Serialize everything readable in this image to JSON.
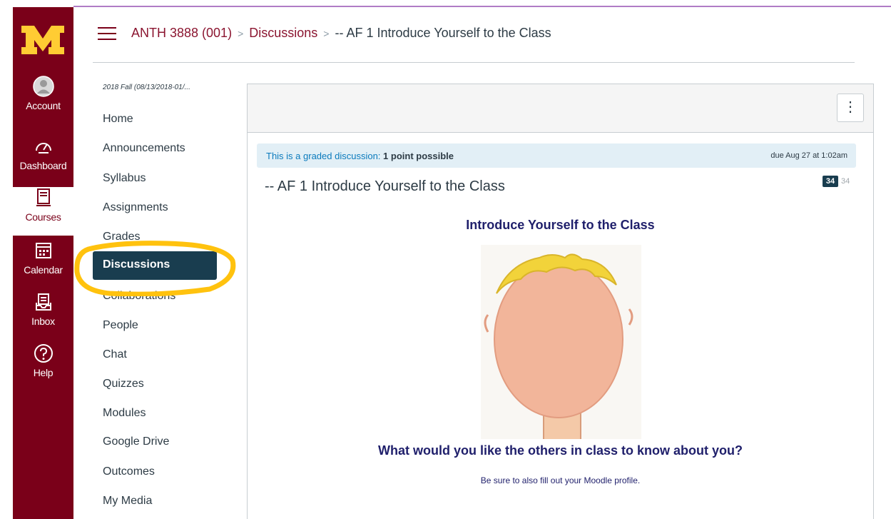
{
  "global_nav": {
    "logo_alt": "M",
    "items": [
      {
        "label": "Account",
        "icon": "avatar-icon"
      },
      {
        "label": "Dashboard",
        "icon": "speedometer-icon"
      },
      {
        "label": "Courses",
        "icon": "book-icon",
        "active": true
      },
      {
        "label": "Calendar",
        "icon": "calendar-icon"
      },
      {
        "label": "Inbox",
        "icon": "inbox-icon"
      },
      {
        "label": "Help",
        "icon": "question-circle-icon"
      }
    ]
  },
  "breadcrumb": {
    "course": "ANTH 3888 (001)",
    "section": "Discussions",
    "current": "-- AF 1 Introduce Yourself to the Class",
    "separator": ">"
  },
  "course_nav": {
    "term": "2018 Fall (08/13/2018-01/...",
    "items": [
      "Home",
      "Announcements",
      "Syllabus",
      "Assignments",
      "Grades",
      "Discussions",
      "Collaborations",
      "People",
      "Chat",
      "Quizzes",
      "Modules",
      "Google Drive",
      "Outcomes",
      "My Media"
    ],
    "active": "Discussions"
  },
  "discussion": {
    "kebab": "⋮",
    "graded_lead": "This is a graded discussion:",
    "graded_points": "1 point possible",
    "due": "due Aug 27 at 1:02am",
    "title": "-- AF 1 Introduce Yourself to the Class",
    "unread_count": "34",
    "total_count": "34",
    "heading": "Introduce Yourself to the Class",
    "question": "What would you like the others in class to know about you?",
    "note": "Be sure to also fill out your Moodle profile."
  },
  "colors": {
    "brand_maroon": "#7a0019",
    "brand_gold": "#ffcc33",
    "active_nav": "#193d4f",
    "highlight_ring": "#ffc20e",
    "message_text": "#1f1f6b"
  }
}
